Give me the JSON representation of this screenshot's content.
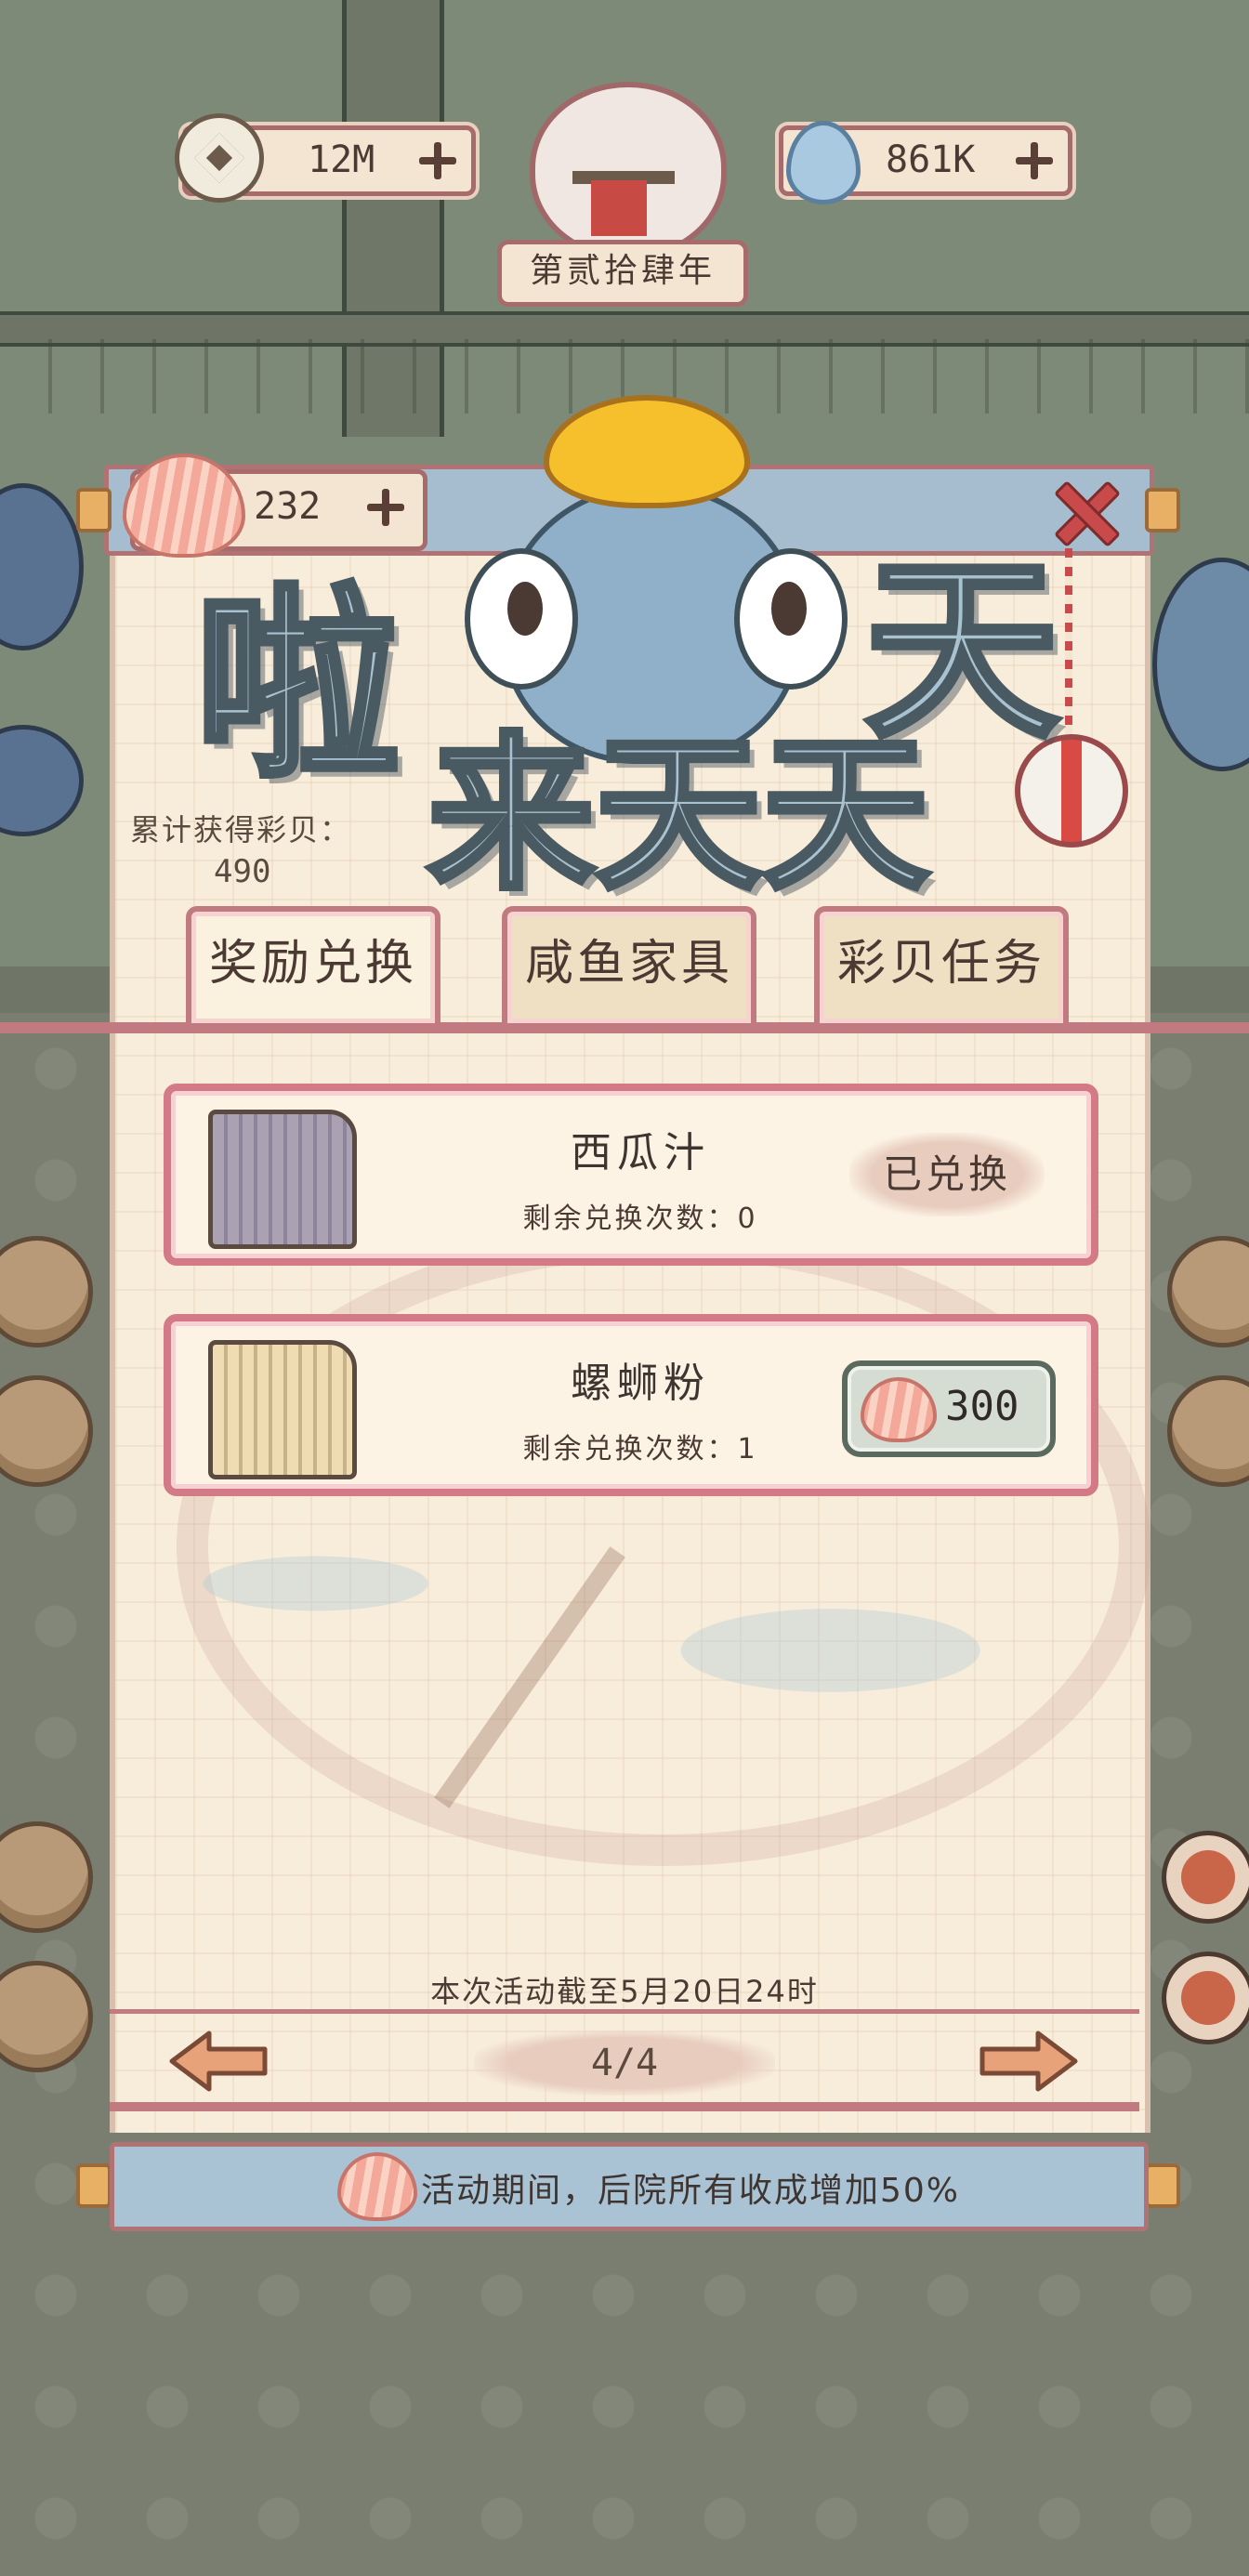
{
  "resources": {
    "coins": "12M",
    "water": "861K",
    "year": "第贰拾肆年"
  },
  "event": {
    "shell_count": "232",
    "title_line1": "啦",
    "title_line2": "天",
    "title_line3": "来天天",
    "total_label": "累计获得彩贝：",
    "total_value": "490"
  },
  "tabs": [
    {
      "label": "奖励兑换",
      "active": true
    },
    {
      "label": "咸鱼家具",
      "active": false
    },
    {
      "label": "彩贝任务",
      "active": false
    }
  ],
  "items": [
    {
      "name": "西瓜汁",
      "remain": "剩余兑换次数：0",
      "status": "已兑换",
      "color": "grey"
    },
    {
      "name": "螺蛳粉",
      "remain": "剩余兑换次数：1",
      "cost": "300",
      "color": "tan"
    }
  ],
  "footer": {
    "deadline": "本次活动截至5月20日24时",
    "page": "4/4",
    "bonus": "活动期间，后院所有收成增加50%"
  },
  "colors": {
    "accent_pink": "#c07a80",
    "panel_bg": "#f8edda",
    "bonus_bg": "#a9c2d4"
  }
}
